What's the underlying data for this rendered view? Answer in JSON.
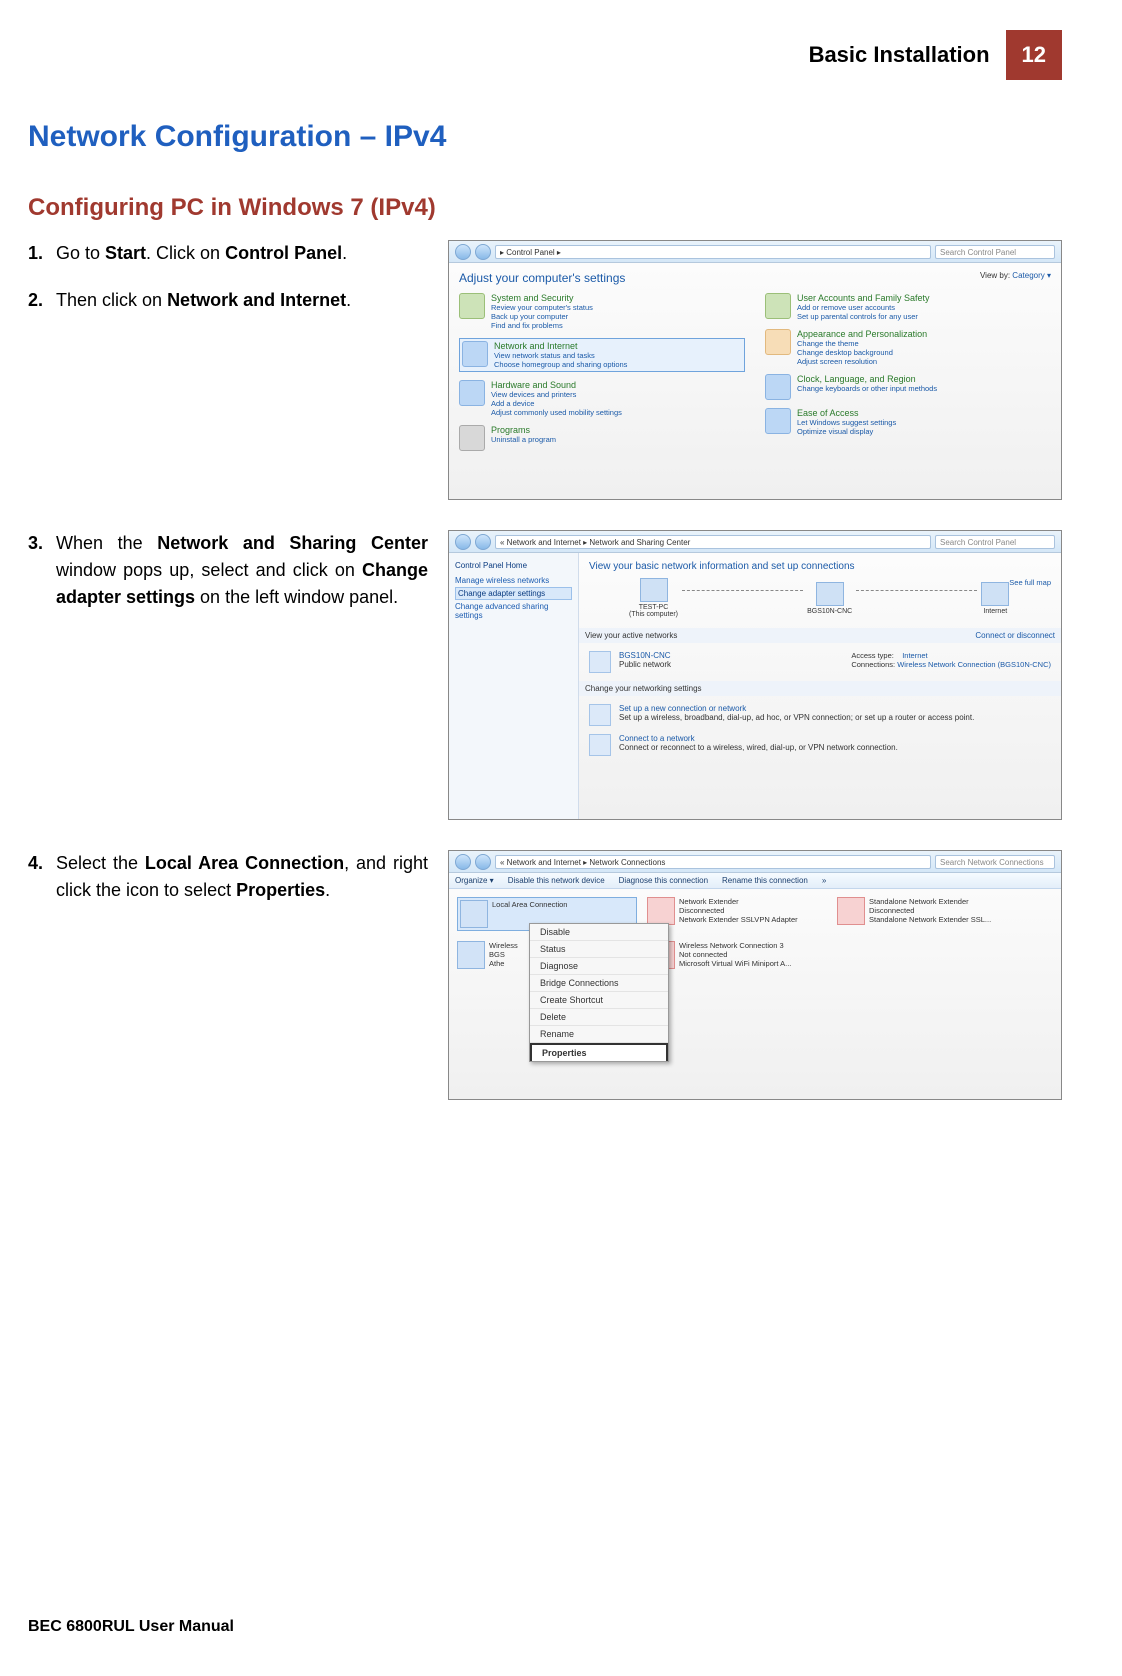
{
  "header": {
    "section": "Basic Installation",
    "page": "12"
  },
  "title": "Network Configuration – IPv4",
  "subtitle": "Configuring PC in Windows 7 (IPv4)",
  "steps": {
    "s1": {
      "num": "1.",
      "pre": "Go to ",
      "b1": "Start",
      "mid": ". Click on ",
      "b2": "Control Panel",
      "post": "."
    },
    "s2": {
      "num": "2.",
      "pre": "Then click on ",
      "b1": "Network and Internet",
      "post": "."
    },
    "s3": {
      "num": "3.",
      "pre": "When the ",
      "b1": "Network and Sharing Center",
      "mid": " window pops up, select and click on ",
      "b2": "Change adapter settings",
      "post": " on the left window panel."
    },
    "s4": {
      "num": "4.",
      "pre": "Select the ",
      "b1": "Local Area Connection",
      "mid": ", and right click the icon to select ",
      "b2": "Properties",
      "post": "."
    }
  },
  "ss1": {
    "breadcrumb": "▸ Control Panel ▸",
    "search": "Search Control Panel",
    "heading": "Adjust your computer's settings",
    "viewby_label": "View by:",
    "viewby_value": "Category ▾",
    "left": [
      {
        "h": "System and Security",
        "l1": "Review your computer's status",
        "l2": "Back up your computer",
        "l3": "Find and fix problems"
      },
      {
        "h": "Network and Internet",
        "l1": "View network status and tasks",
        "l2": "Choose homegroup and sharing options"
      },
      {
        "h": "Hardware and Sound",
        "l1": "View devices and printers",
        "l2": "Add a device",
        "l3": "Adjust commonly used mobility settings"
      },
      {
        "h": "Programs",
        "l1": "Uninstall a program"
      }
    ],
    "right": [
      {
        "h": "User Accounts and Family Safety",
        "l1": "Add or remove user accounts",
        "l2": "Set up parental controls for any user"
      },
      {
        "h": "Appearance and Personalization",
        "l1": "Change the theme",
        "l2": "Change desktop background",
        "l3": "Adjust screen resolution"
      },
      {
        "h": "Clock, Language, and Region",
        "l1": "Change keyboards or other input methods"
      },
      {
        "h": "Ease of Access",
        "l1": "Let Windows suggest settings",
        "l2": "Optimize visual display"
      }
    ]
  },
  "ss2": {
    "breadcrumb": "« Network and Internet ▸ Network and Sharing Center",
    "search": "Search Control Panel",
    "lefthome": "Control Panel Home",
    "leftlinks": [
      "Manage wireless networks",
      "Change adapter settings",
      "Change advanced sharing settings"
    ],
    "heading": "View your basic network information and set up connections",
    "seefull": "See full map",
    "nodes": [
      "TEST-PC",
      "(This computer)",
      "BGS10N-CNC",
      "Internet"
    ],
    "sec1": "View your active networks",
    "conn_disc": "Connect or disconnect",
    "active_name": "BGS10N-CNC",
    "active_type": "Public network",
    "access_label": "Access type:",
    "access_val": "Internet",
    "conns_label": "Connections:",
    "conns_val": "Wireless Network Connection (BGS10N-CNC)",
    "sec2": "Change your networking settings",
    "opt1h": "Set up a new connection or network",
    "opt1d": "Set up a wireless, broadband, dial-up, ad hoc, or VPN connection; or set up a router or access point.",
    "opt2h": "Connect to a network",
    "opt2d": "Connect or reconnect to a wireless, wired, dial-up, or VPN network connection."
  },
  "ss3": {
    "breadcrumb": "« Network and Internet ▸ Network Connections",
    "search": "Search Network Connections",
    "toolbar": [
      "Organize ▾",
      "Disable this network device",
      "Diagnose this connection",
      "Rename this connection",
      "»"
    ],
    "items": [
      {
        "name": "Local Area Connection",
        "s1": "",
        "s2": ""
      },
      {
        "name": "Network Extender",
        "s1": "Disconnected",
        "s2": "Network Extender SSLVPN Adapter"
      },
      {
        "name": "Standalone Network Extender",
        "s1": "Disconnected",
        "s2": "Standalone Network Extender SSL..."
      },
      {
        "name": "Wireless",
        "s1": "BGS",
        "s2": "Athe"
      },
      {
        "name": "Wireless Network Connection 3",
        "s1": "Not connected",
        "s2": "Microsoft Virtual WiFi Miniport A..."
      }
    ],
    "menu": [
      "Disable",
      "Status",
      "Diagnose",
      "Bridge Connections",
      "Create Shortcut",
      "Delete",
      "Rename",
      "Properties"
    ]
  },
  "footer": "BEC 6800RUL User Manual"
}
